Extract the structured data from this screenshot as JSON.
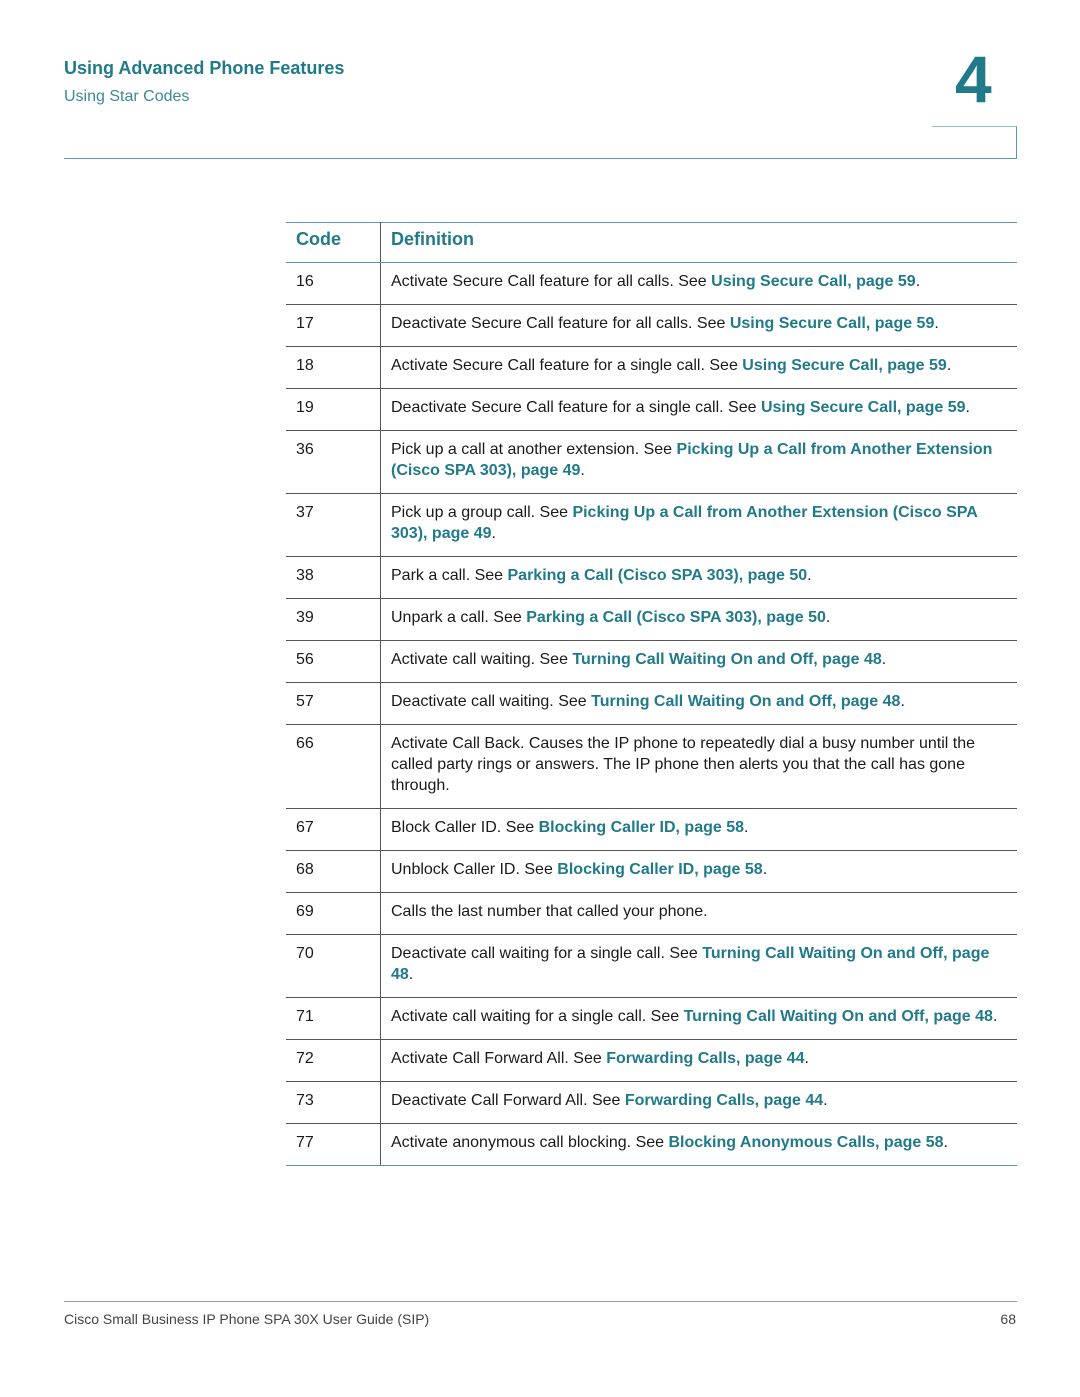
{
  "header": {
    "chapter_title": "Using Advanced Phone Features",
    "section_title": "Using Star Codes",
    "chapter_number": "4"
  },
  "table": {
    "columns": [
      "Code",
      "Definition"
    ],
    "rows": [
      {
        "code": "16",
        "text": "Activate Secure Call feature for all calls. See ",
        "link": "Using Secure Call, page 59",
        "after": "."
      },
      {
        "code": "17",
        "text": "Deactivate Secure Call feature for all calls. See ",
        "link": "Using Secure Call, page 59",
        "after": "."
      },
      {
        "code": "18",
        "text": "Activate Secure Call feature for a single call. See ",
        "link": "Using Secure Call, page 59",
        "after": "."
      },
      {
        "code": "19",
        "text": "Deactivate Secure Call feature for a single call. See ",
        "link": "Using Secure Call, page 59",
        "after": "."
      },
      {
        "code": "36",
        "text": "Pick up a call at another extension. See ",
        "link": "Picking Up a Call from Another Extension (Cisco SPA 303), page 49",
        "after": "."
      },
      {
        "code": "37",
        "text": "Pick up a group call. See ",
        "link": "Picking Up a Call from Another Extension (Cisco SPA 303), page 49",
        "after": "."
      },
      {
        "code": "38",
        "text": "Park a call. See ",
        "link": "Parking a Call (Cisco SPA 303), page 50",
        "after": "."
      },
      {
        "code": "39",
        "text": "Unpark a call. See ",
        "link": "Parking a Call (Cisco SPA 303), page 50",
        "after": "."
      },
      {
        "code": "56",
        "text": "Activate call waiting. See ",
        "link": "Turning Call Waiting On and Off, page 48",
        "after": "."
      },
      {
        "code": "57",
        "text": "Deactivate call waiting. See ",
        "link": "Turning Call Waiting On and Off, page 48",
        "after": "."
      },
      {
        "code": "66",
        "text": "Activate Call Back. Causes the IP phone to repeatedly dial a busy number until the called party rings or answers. The IP phone then alerts you that the call has gone through.",
        "link": "",
        "after": ""
      },
      {
        "code": "67",
        "text": "Block Caller ID. See ",
        "link": "Blocking Caller ID, page 58",
        "after": "."
      },
      {
        "code": "68",
        "text": "Unblock Caller ID. See ",
        "link": "Blocking Caller ID, page 58",
        "after": "."
      },
      {
        "code": "69",
        "text": "Calls the last number that called your phone.",
        "link": "",
        "after": ""
      },
      {
        "code": "70",
        "text": "Deactivate call waiting for a single call. See ",
        "link": "Turning Call Waiting On and Off, page 48",
        "after": "."
      },
      {
        "code": "71",
        "text": "Activate call waiting for a single call. See ",
        "link": "Turning Call Waiting On and Off, page 48",
        "after": "."
      },
      {
        "code": "72",
        "text": "Activate Call Forward All. See ",
        "link": "Forwarding Calls, page 44",
        "after": "."
      },
      {
        "code": "73",
        "text": "Deactivate Call Forward All. See ",
        "link": "Forwarding Calls, page 44",
        "after": "."
      },
      {
        "code": "77",
        "text": "Activate anonymous call blocking. See ",
        "link": "Blocking Anonymous Calls, page 58",
        "after": "."
      }
    ]
  },
  "footer": {
    "guide_title": "Cisco Small Business IP Phone SPA 30X User Guide (SIP)",
    "page_number": "68"
  },
  "colors": {
    "accent": "#217a8a",
    "rule": "#5b95b3"
  }
}
